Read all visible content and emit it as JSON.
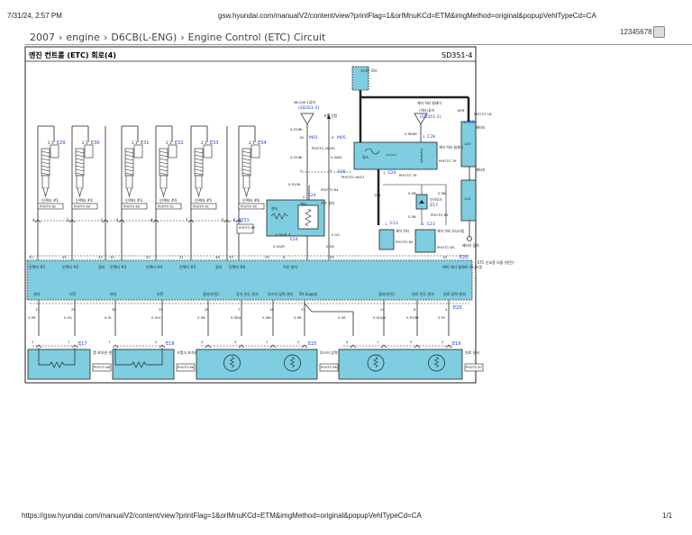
{
  "print_header": {
    "date": "7/31/24, 2:57 PM",
    "url": "gsw.hyundai.com/manualV2/content/view?printFlag=1&orlMnuKCd=ETM&imgMethod=original&popupVehlTypeCd=CA"
  },
  "breadcrumb": [
    "2007",
    "engine",
    "D6CB(L-ENG)",
    "Engine Control (ETC) Circuit"
  ],
  "page_id": "12345678",
  "diagram": {
    "title": "엔진 컨트롤 (ETC) 회로(4)",
    "code": "SD351-4",
    "colors": {
      "component_fill": "#7ecde0",
      "connector_blue": "#1a3fd8"
    },
    "injectors": [
      {
        "label": "인젝터 #1",
        "pins": "2  1",
        "connector": "E29",
        "photo": "PHOTO 62",
        "cpin": "4"
      },
      {
        "label": "인젝터 #2",
        "pins": "2  1",
        "connector": "E30",
        "photo": "PHOTO 60",
        "cpin": "3"
      },
      {
        "label": "인젝터 #3",
        "pins": "2  1",
        "connector": "E31",
        "photo": "PHOTO 60",
        "cpin": "2"
      },
      {
        "label": "인젝터 #4",
        "pins": "2  1",
        "connector": "E32",
        "photo": "PHOTO 61",
        "cpin": "8"
      },
      {
        "label": "인젝터 #5",
        "pins": "2  1",
        "connector": "E33",
        "photo": "PHOTO 61",
        "cpin": "7"
      },
      {
        "label": "인젝터 #6",
        "pins": "2  1",
        "connector": "E34",
        "photo": "PHOTO 60",
        "cpin": "6"
      }
    ],
    "injector_connector": {
      "name": "E031",
      "photo": "PHOTO 66",
      "extra_pins": [
        "1",
        "5"
      ]
    },
    "ecm_top_pins": [
      {
        "pin": "20",
        "label": "인젝터 #1"
      },
      {
        "pin": "45",
        "label": "인젝터 #2"
      },
      {
        "pin": "43",
        "label": "접지"
      },
      {
        "pin": "30",
        "label": "인젝터 #3"
      },
      {
        "pin": "32",
        "label": "인젝터 #4"
      },
      {
        "pin": "31",
        "label": "인젝터 #5"
      },
      {
        "pin": "46",
        "label": "접지"
      },
      {
        "pin": "33",
        "label": "인젝터 #6"
      },
      {
        "pin": "29",
        "label": ""
      },
      {
        "pin": "6",
        "label": "수온 센서"
      },
      {
        "pin": "55",
        "label": ""
      },
      {
        "pin": "16",
        "label": "에어 히터 릴레이 모니터링"
      }
    ],
    "ecm_bottom_pins": [
      {
        "pin": "11",
        "label": "센서",
        "wire": "0.5R"
      },
      {
        "pin": "25",
        "label": "리턴",
        "wire": "0.5G"
      },
      {
        "pin": "38",
        "label": "센서",
        "wire": "0.5L"
      },
      {
        "pin": "39",
        "label": "리턴",
        "wire": "0.5Gr"
      },
      {
        "pin": "28",
        "label": "접지(리턴)",
        "wire": "0.5B"
      },
      {
        "pin": "7",
        "label": "공기 온도 센서",
        "wire": "0.5R/L"
      },
      {
        "pin": "18",
        "label": "부스터 압력 센서",
        "wire": "0.5Br"
      },
      {
        "pin": "37",
        "label": "5V Supply",
        "wire": "0.5R"
      },
      {
        "pin": "22",
        "label": "접지(리턴)",
        "wire": "0.5G/W"
      },
      {
        "pin": "8",
        "label": "연료 온도 센서",
        "wire": "0.5Y/Br"
      },
      {
        "pin": "4",
        "label": "연료 압력 센서",
        "wire": "0.5Y"
      }
    ],
    "ecm_connector": "E20",
    "ecm_name": "ETC 신호용 모듈 (엔진)",
    "jog_wire": "0.5R",
    "sensors": [
      {
        "connector": "E17",
        "pins": [
          "2",
          "1"
        ],
        "name": "캠 포지션 센서",
        "photo": "PHOTO 68"
      },
      {
        "connector": "E18",
        "pins": [
          "1",
          "2"
        ],
        "name": "크랭크 포지션 센서",
        "photo": "PHOTO 68"
      },
      {
        "connector": "E25",
        "pins": [
          "4",
          "3",
          "1",
          "2"
        ],
        "name": "부스터 압력 센서",
        "photo": "PHOTO 66"
      },
      {
        "connector": "E19",
        "pins": [
          "4",
          "1",
          "3",
          "2"
        ],
        "name": "연료 센서",
        "photo": "PHOTO 67"
      }
    ],
    "labels": [
      {
        "text": "MICOM 1퓨저"
      },
      {
        "text": "(SD351-2)"
      },
      {
        "text": "0.5Y/Br"
      },
      {
        "text": "16"
      },
      {
        "text": "M01"
      },
      {
        "text": "PHOTO 28/30"
      },
      {
        "text": "0.5Y/Br"
      },
      {
        "text": "2"
      },
      {
        "text": "E05"
      },
      {
        "text": "0.5Y/W"
      },
      {
        "text": "2"
      },
      {
        "text": "E24"
      },
      {
        "text": "PHOTO 64"
      },
      {
        "text": "수온 센서"
      },
      {
        "text": "센서"
      },
      {
        "text": "센더"
      },
      {
        "text": "3"
      },
      {
        "text": "E24"
      },
      {
        "text": "0.5G/R"
      },
      {
        "text": "사용 안함"
      },
      {
        "text": "9"
      },
      {
        "text": "M05"
      },
      {
        "text": "0.5W/L"
      },
      {
        "text": "5"
      },
      {
        "text": "PHOTO 26/27"
      },
      {
        "text": "0.5G"
      },
      {
        "text": "스타트 모터"
      },
      {
        "text": "에어 히터 릴레이"
      },
      {
        "text": "(히터)퓨저"
      },
      {
        "text": "(SD351-1)"
      },
      {
        "text": "0.5R/Br"
      },
      {
        "text": "1"
      },
      {
        "text": "C28"
      },
      {
        "text": "에어 히터 릴레이"
      },
      {
        "text": "PHOTO 78"
      },
      {
        "text": "퓨즈"
      },
      {
        "text": "1"
      },
      {
        "text": "E26"
      },
      {
        "text": "PHOTO 76"
      },
      {
        "text": "15B"
      },
      {
        "text": "0.5B"
      },
      {
        "text": "0.5B"
      },
      {
        "text": "다이오드"
      },
      {
        "text": "Z17"
      },
      {
        "text": "PHOTO 65"
      },
      {
        "text": "0.5B"
      },
      {
        "text": "1"
      },
      {
        "text": "E13"
      },
      {
        "text": "에어 히터"
      },
      {
        "text": "PHOTO 65"
      },
      {
        "text": "1"
      },
      {
        "text": "E23"
      },
      {
        "text": "에어 히터 모니터링"
      },
      {
        "text": "PHOTO 65"
      },
      {
        "text": "60R"
      },
      {
        "text": "PHOTO 18"
      },
      {
        "text": "1"
      },
      {
        "text": "E29"
      },
      {
        "text": "배터리"
      },
      {
        "text": "12V"
      },
      {
        "text": "배터리"
      },
      {
        "text": "12V"
      },
      {
        "text": "배터리 접지"
      },
      {
        "text": "0.5Y/R"
      },
      {
        "text": "0.5G"
      }
    ]
  },
  "footer": {
    "url": "https://gsw.hyundai.com/manualV2/content/view?printFlag=1&orlMnuKCd=ETM&imgMethod=original&popupVehlTypeCd=CA",
    "page": "1/1"
  }
}
